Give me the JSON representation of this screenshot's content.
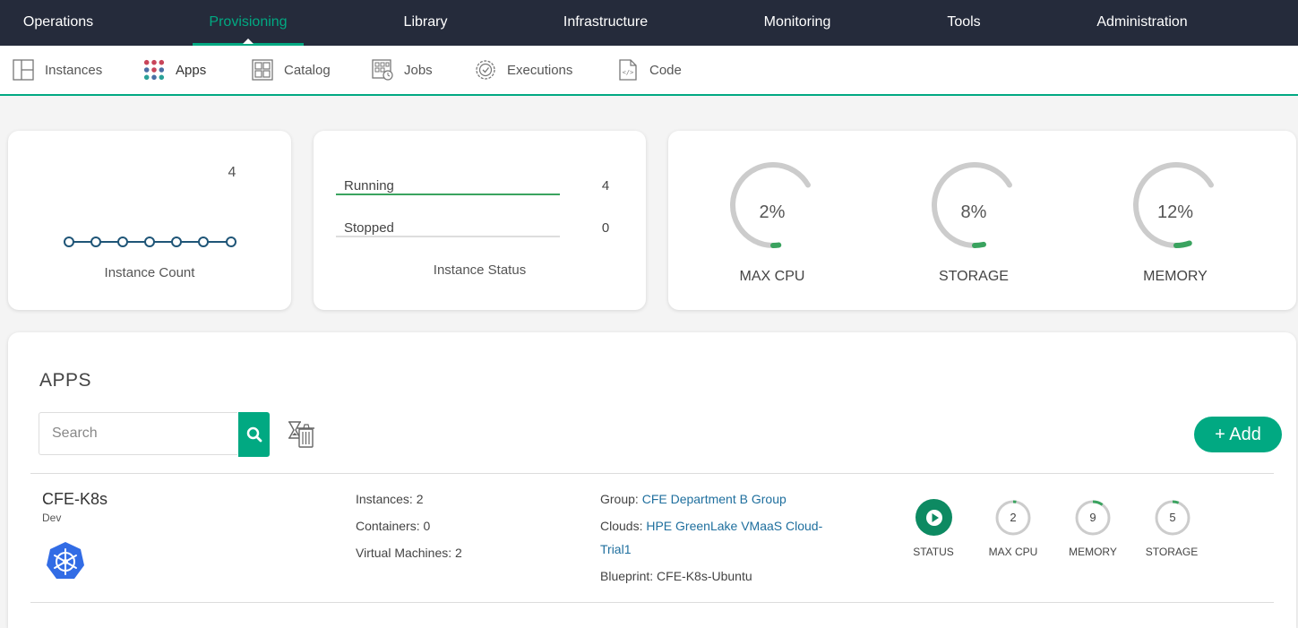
{
  "topnav": {
    "items": [
      {
        "label": "Operations",
        "active": false
      },
      {
        "label": "Provisioning",
        "active": true
      },
      {
        "label": "Library",
        "active": false
      },
      {
        "label": "Infrastructure",
        "active": false
      },
      {
        "label": "Monitoring",
        "active": false
      },
      {
        "label": "Tools",
        "active": false
      },
      {
        "label": "Administration",
        "active": false
      }
    ]
  },
  "subnav": {
    "items": [
      {
        "label": "Instances",
        "icon": "instances-icon"
      },
      {
        "label": "Apps",
        "icon": "apps-icon",
        "active": true
      },
      {
        "label": "Catalog",
        "icon": "catalog-icon"
      },
      {
        "label": "Jobs",
        "icon": "jobs-icon"
      },
      {
        "label": "Executions",
        "icon": "executions-icon"
      },
      {
        "label": "Code",
        "icon": "code-icon"
      }
    ]
  },
  "instance_count": {
    "value": "4",
    "label": "Instance Count"
  },
  "instance_status": {
    "rows": [
      {
        "label": "Running",
        "count": "4",
        "fraction": 1.0
      },
      {
        "label": "Stopped",
        "count": "0",
        "fraction": 0.0
      }
    ],
    "label": "Instance Status"
  },
  "gauges": [
    {
      "value": "2%",
      "label": "MAX CPU",
      "percent": 2
    },
    {
      "value": "8%",
      "label": "STORAGE",
      "percent": 8
    },
    {
      "value": "12%",
      "label": "MEMORY",
      "percent": 12
    }
  ],
  "apps": {
    "title": "APPS",
    "search_placeholder": "Search",
    "add_label": "+ Add",
    "rows": [
      {
        "name": "CFE-K8s",
        "env": "Dev",
        "instances": "Instances: 2",
        "containers": "Containers: 0",
        "vms": "Virtual Machines: 2",
        "group_label": "Group: ",
        "group_value": "CFE Department B Group",
        "clouds_label": "Clouds: ",
        "clouds_value_1": "HPE GreenLake VMaaS Cloud-",
        "clouds_value_2": "Trial1",
        "blueprint": "Blueprint: CFE-K8s-Ubuntu",
        "status_label": "STATUS",
        "stats": [
          {
            "value": "2",
            "label": "MAX CPU"
          },
          {
            "value": "9",
            "label": "MEMORY"
          },
          {
            "value": "5",
            "label": "STORAGE"
          }
        ]
      }
    ]
  },
  "colors": {
    "accent": "#01a982",
    "nav_bg": "#252b3b",
    "link": "#1f6f9e",
    "gauge_track": "#cccccc",
    "gauge_fill": "#3aa35f"
  }
}
